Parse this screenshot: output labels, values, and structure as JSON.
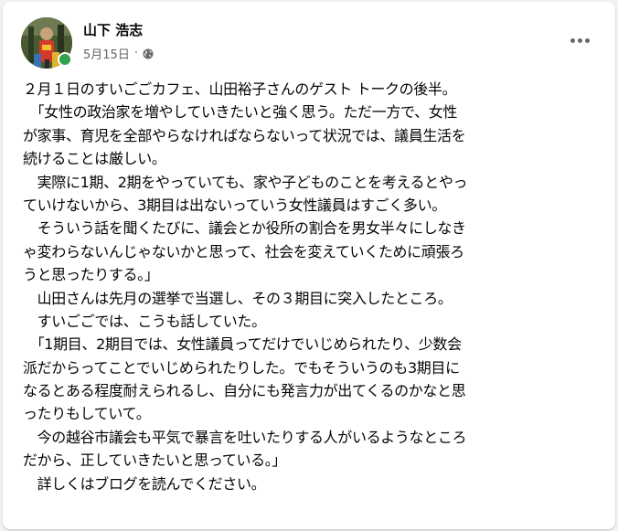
{
  "post": {
    "author": "山下 浩志",
    "date": "5月15日",
    "separator": "·",
    "visibility_icon": "globe-icon",
    "more_icon": "more-horizontal-icon",
    "lines": [
      "２月１日のすいごごカフェ、山田裕子さんのゲスト トークの後半。",
      "　「女性の政治家を増やしていきたいと強く思う。ただ一方で、女性",
      "が家事、育児を全部やらなければならないって状況では、議員生活を",
      "続けることは厳しい。",
      "　実際に1期、2期をやっていても、家や子どものことを考えるとやっ",
      "ていけないから、3期目は出ないっていう女性議員はすごく多い。",
      "　そういう話を聞くたびに、議会とか役所の割合を男女半々にしなき",
      "ゃ変わらないんじゃないかと思って、社会を変えていくために頑張ろ",
      "うと思ったりする。」",
      "　山田さんは先月の選挙で当選し、その３期目に突入したところ。",
      "　すいごごでは、こうも話していた。",
      "　「1期目、2期目では、女性議員ってだけでいじめられたり、少数会",
      "派だからってことでいじめられたりした。でもそういうのも3期目に",
      "なるとある程度耐えられるし、自分にも発言力が出てくるのかなと思",
      "ったりもしていて。",
      "　今の越谷市議会も平気で暴言を吐いたりする人がいるようなところ",
      "だから、正していきたいと思っている。」",
      "　詳しくはブログを読んでください。"
    ]
  },
  "colors": {
    "background": "#f0f2f5",
    "card": "#ffffff",
    "text": "#050505",
    "secondary_text": "#65676b",
    "online": "#31a24c"
  }
}
